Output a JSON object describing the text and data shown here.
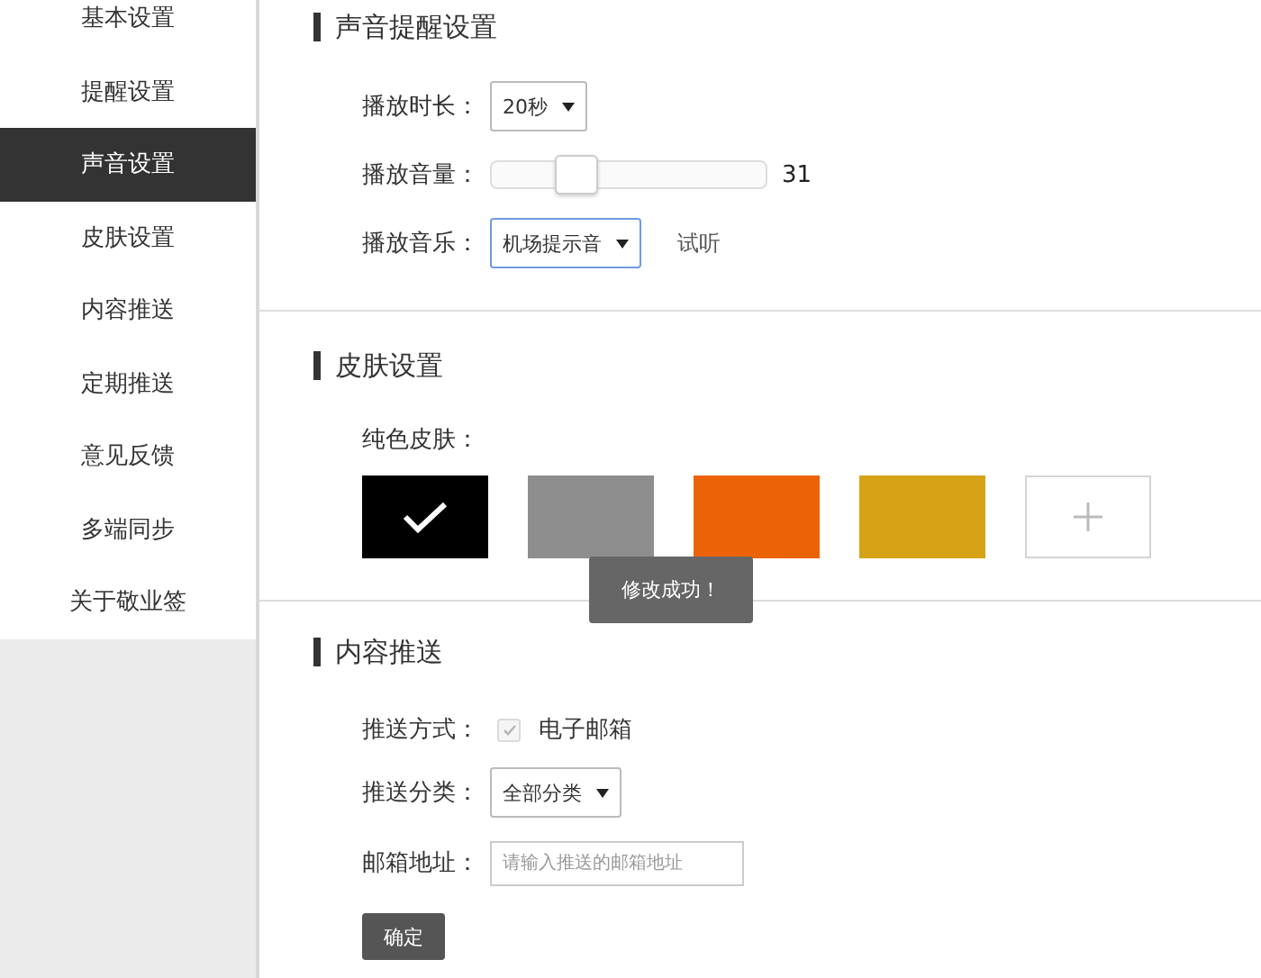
{
  "sidebar": {
    "items": [
      {
        "label": "基本设置",
        "selected": false
      },
      {
        "label": "提醒设置",
        "selected": false
      },
      {
        "label": "声音设置",
        "selected": true
      },
      {
        "label": "皮肤设置",
        "selected": false
      },
      {
        "label": "内容推送",
        "selected": false
      },
      {
        "label": "定期推送",
        "selected": false
      },
      {
        "label": "意见反馈",
        "selected": false
      },
      {
        "label": "多端同步",
        "selected": false
      },
      {
        "label": "关于敬业签",
        "selected": false
      }
    ]
  },
  "sound": {
    "title": "声音提醒设置",
    "duration": {
      "label": "播放时长：",
      "value": "20秒"
    },
    "volume": {
      "label": "播放音量：",
      "level": 0.31,
      "reading": "31"
    },
    "music": {
      "label": "播放音乐：",
      "value": "机场提示音",
      "focused": true,
      "preview": "试听"
    }
  },
  "skin": {
    "title": "皮肤设置",
    "label": "纯色皮肤：",
    "swatches": [
      {
        "kind": "color",
        "color": "#000000",
        "selected": true
      },
      {
        "kind": "color",
        "color": "#8e8e8e",
        "selected": false
      },
      {
        "kind": "color",
        "color": "#ec6207",
        "selected": false
      },
      {
        "kind": "color",
        "color": "#d6a316",
        "selected": false
      },
      {
        "kind": "add"
      }
    ]
  },
  "toast": "修改成功！",
  "push": {
    "title": "内容推送",
    "method": {
      "label": "推送方式：",
      "option": "电子邮箱",
      "checked": true,
      "disabled": true
    },
    "category": {
      "label": "推送分类：",
      "value": "全部分类"
    },
    "email": {
      "label": "邮箱地址：",
      "placeholder": "请输入推送的邮箱地址"
    },
    "submit": "确定"
  }
}
